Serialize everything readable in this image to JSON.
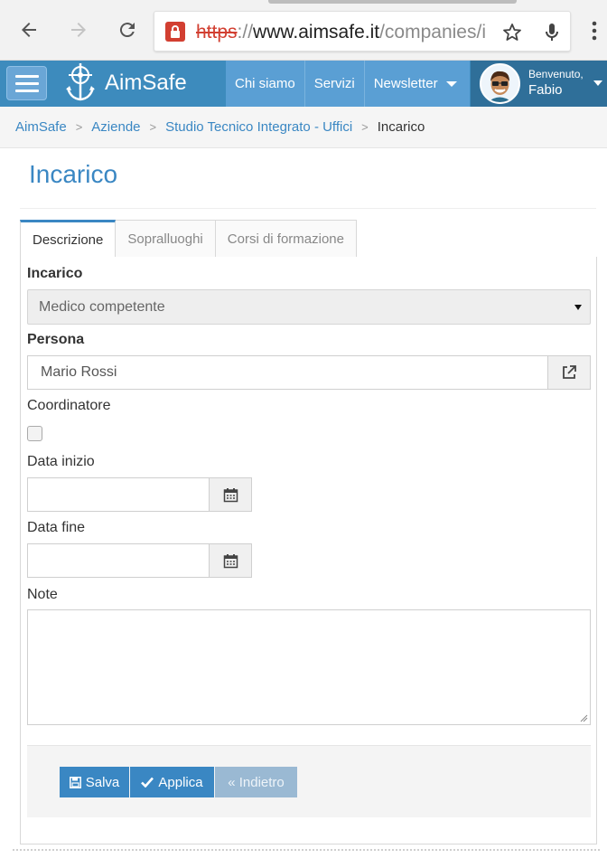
{
  "browser": {
    "url": {
      "scheme": "https",
      "separator": "://",
      "host": "www.aimsafe.it",
      "path": "/companies/i"
    },
    "icons": [
      "back-icon",
      "forward-icon",
      "reload-icon",
      "lock-icon",
      "star-icon",
      "mic-icon",
      "more-icon"
    ]
  },
  "header": {
    "brand": "AimSafe",
    "menu": [
      "Chi siamo",
      "Servizi",
      "Newsletter"
    ],
    "user": {
      "greeting": "Benvenuto,",
      "name": "Fabio"
    }
  },
  "breadcrumb": {
    "items": [
      "AimSafe",
      "Aziende",
      "Studio Tecnico Integrato - Uffici"
    ],
    "current": "Incarico",
    "separator": ">"
  },
  "page": {
    "title": "Incarico",
    "tabs": [
      "Descrizione",
      "Sopralluoghi",
      "Corsi di formazione"
    ],
    "active_tab": "Descrizione"
  },
  "form": {
    "incarico": {
      "label": "Incarico",
      "value": "Medico competente"
    },
    "persona": {
      "label": "Persona",
      "value": "Mario  Rossi"
    },
    "coordinatore": {
      "label": "Coordinatore",
      "checked": false
    },
    "data_inizio": {
      "label": "Data inizio",
      "value": ""
    },
    "data_fine": {
      "label": "Data fine",
      "value": ""
    },
    "note": {
      "label": "Note",
      "value": ""
    }
  },
  "actions": {
    "save": "Salva",
    "apply": "Applica",
    "back": "« Indietro"
  },
  "colors": {
    "appbar": "#3d8bbd",
    "menu": "#5a9fd4",
    "user_block": "#2f6f99",
    "accent": "#3a87c3",
    "disabled_button": "#9ab9d3"
  }
}
